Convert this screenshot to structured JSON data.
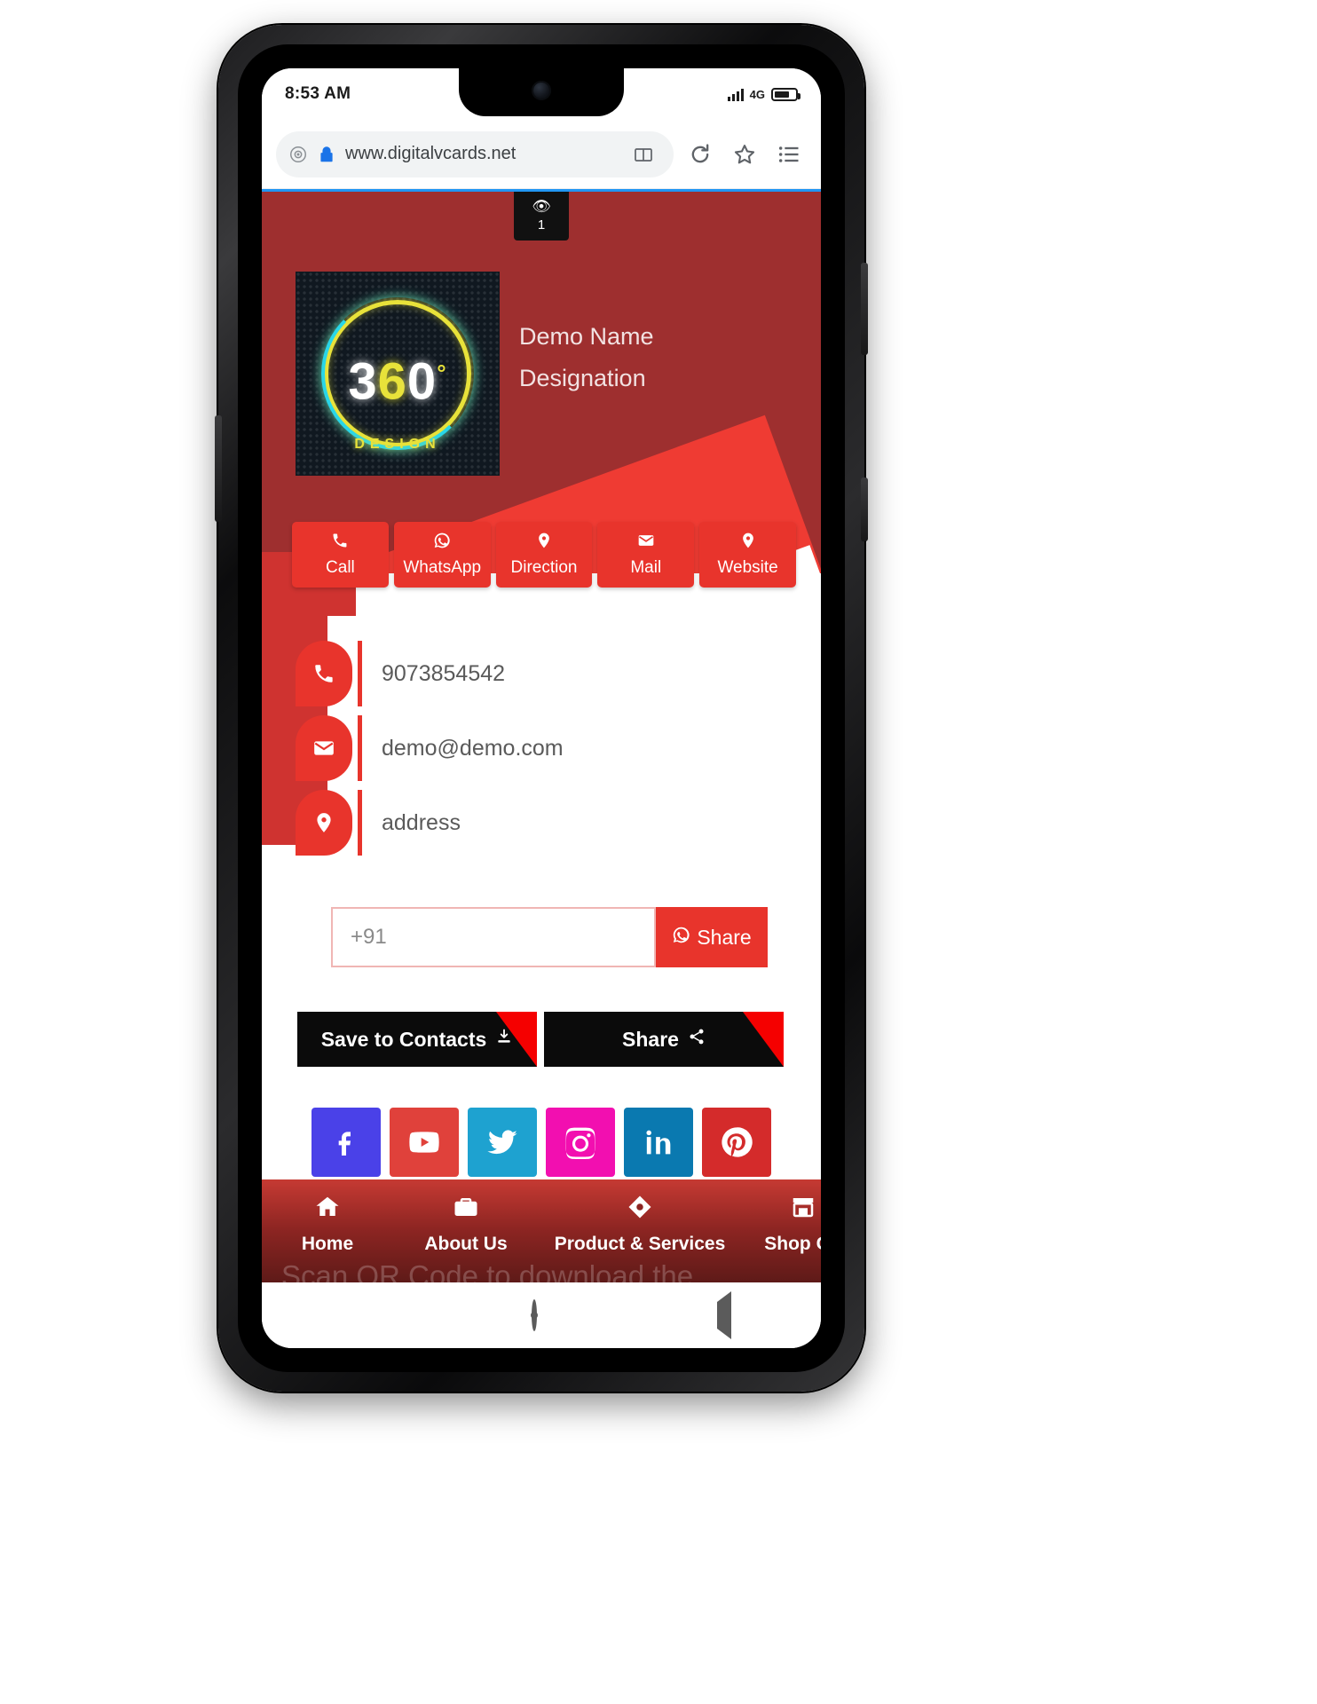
{
  "status_bar": {
    "time": "8:53 AM",
    "signal_icon": "signal-bars-icon",
    "network_label": "4G",
    "battery_icon": "battery-icon"
  },
  "browser": {
    "url": "www.digitalvcards.net",
    "shield_icon": "tracking-protection-icon",
    "lock_icon": "secure-lock-icon",
    "reader_icon": "reader-mode-icon",
    "reload_icon": "reload-icon",
    "bookmark_icon": "star-bookmark-icon",
    "menu_icon": "list-menu-icon"
  },
  "hero": {
    "view_badge": {
      "icon": "eye-icon",
      "count": "1"
    },
    "logo": {
      "text_w": "3",
      "text_y": "6",
      "text_w2": "0",
      "degree": "°",
      "sub": "DESIGN"
    },
    "name": "Demo Name",
    "designation": "Designation"
  },
  "actions": [
    {
      "label": "Call",
      "icon": "phone-icon",
      "glyph": "☎"
    },
    {
      "label": "WhatsApp",
      "icon": "whatsapp-icon",
      "glyph": "○"
    },
    {
      "label": "Direction",
      "icon": "map-pin-icon",
      "glyph": "●"
    },
    {
      "label": "Mail",
      "icon": "envelope-icon",
      "glyph": "✉"
    },
    {
      "label": "Website",
      "icon": "globe-pin-icon",
      "glyph": "●"
    }
  ],
  "contacts": [
    {
      "icon": "phone-icon",
      "value": "9073854542"
    },
    {
      "icon": "envelope-icon",
      "value": "demo@demo.com"
    },
    {
      "icon": "map-pin-icon",
      "value": "address"
    }
  ],
  "share_input": {
    "placeholder": "+91",
    "value": "",
    "button_label": "Share",
    "button_icon": "whatsapp-icon"
  },
  "cta": [
    {
      "label": "Save to Contacts",
      "icon": "download-icon",
      "glyph": "⤓"
    },
    {
      "label": "Share",
      "icon": "share-nodes-icon",
      "glyph": "➦"
    }
  ],
  "social": [
    {
      "name": "facebook-icon",
      "color": "#4a41e8"
    },
    {
      "name": "youtube-icon",
      "color": "#e0413b"
    },
    {
      "name": "twitter-icon",
      "color": "#1ea2d0"
    },
    {
      "name": "instagram-icon",
      "color": "#f20fb0"
    },
    {
      "name": "linkedin-icon",
      "color": "#0a79b0"
    },
    {
      "name": "pinterest-icon",
      "color": "#d42b2b"
    }
  ],
  "bottom_nav": [
    {
      "label": "Home",
      "icon": "home-icon",
      "glyph": "⌂"
    },
    {
      "label": "About Us",
      "icon": "briefcase-icon",
      "glyph": "▬"
    },
    {
      "label": "Product & Services",
      "icon": "tag-icon",
      "glyph": "◆"
    },
    {
      "label": "Shop On",
      "icon": "store-icon",
      "glyph": "▤"
    }
  ],
  "qr_text": "Scan QR Code to download the",
  "android_nav": {
    "recents_icon": "recents-square-icon",
    "home_icon": "home-circle-icon",
    "back_icon": "back-triangle-icon"
  },
  "colors": {
    "brand_red": "#e8342c",
    "hero_dark_red": "#9e2f2f",
    "accent_red": "#ef3b33",
    "nav_gradient_top": "#c63a33",
    "nav_gradient_bottom": "#5e1a18"
  }
}
